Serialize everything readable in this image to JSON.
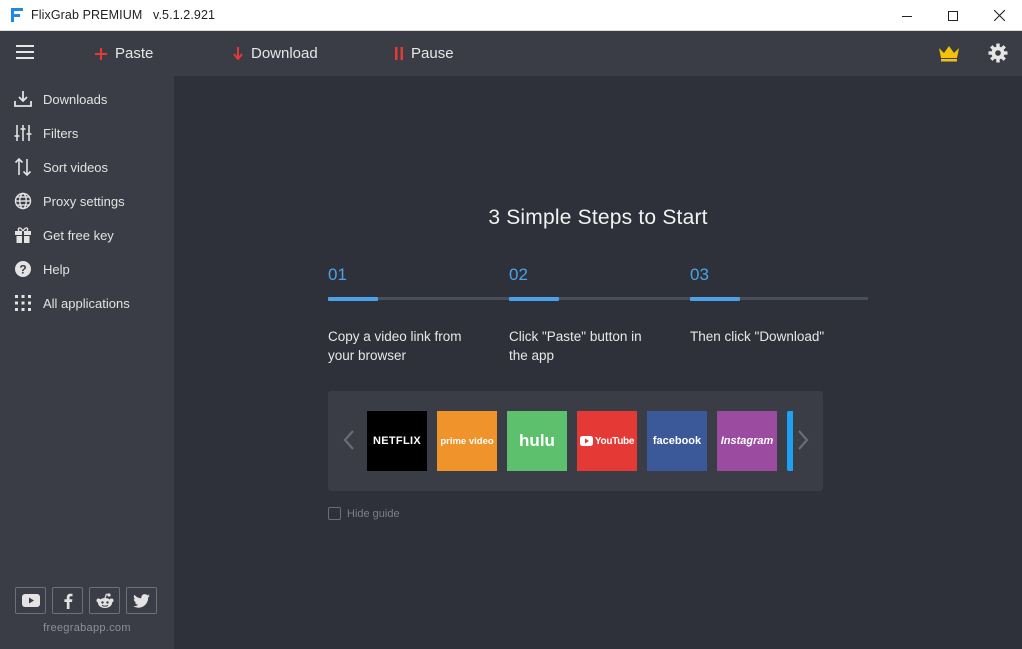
{
  "titlebar": {
    "title": "FlixGrab PREMIUM   v.5.1.2.921"
  },
  "toolbar": {
    "paste_label": "Paste",
    "download_label": "Download",
    "pause_label": "Pause",
    "icons": {
      "menu": "hamburger-menu-icon",
      "paste": "plus-icon",
      "download": "arrow-down-icon",
      "pause": "pause-icon",
      "premium": "crown-icon",
      "settings": "gear-icon"
    }
  },
  "sidebar": {
    "items": [
      {
        "label": "Downloads",
        "icon": "download-tray-icon"
      },
      {
        "label": "Filters",
        "icon": "sliders-icon"
      },
      {
        "label": "Sort videos",
        "icon": "sort-arrows-icon"
      },
      {
        "label": "Proxy settings",
        "icon": "globe-icon"
      },
      {
        "label": "Get free key",
        "icon": "gift-icon"
      },
      {
        "label": "Help",
        "icon": "question-icon"
      },
      {
        "label": "All applications",
        "icon": "grid-dots-icon"
      }
    ],
    "social": [
      "youtube-icon",
      "facebook-icon",
      "reddit-icon",
      "twitter-icon"
    ],
    "site": "freegrabapp.com"
  },
  "guide": {
    "heading": "3 Simple Steps to Start",
    "steps": [
      {
        "num": "01",
        "line1": "Copy a video link from",
        "line2": "your browser"
      },
      {
        "num": "02",
        "line1": "Click \"Paste\" button in",
        "line2": "the app"
      },
      {
        "num": "03",
        "line1": "Then click \"Download\"",
        "line2": ""
      }
    ],
    "services": [
      {
        "name": "NETFLIX",
        "color": "#000000"
      },
      {
        "name": "prime video",
        "color": "#f0932b"
      },
      {
        "name": "hulu",
        "color": "#5cc06c"
      },
      {
        "name": "YouTube",
        "color": "#e53935"
      },
      {
        "name": "facebook",
        "color": "#3b5998"
      },
      {
        "name": "Instagram",
        "color": "#9b4ba0"
      }
    ],
    "hide_label": "Hide guide"
  },
  "colors": {
    "accent": "#4aa3e8",
    "sidebar_bg": "#3a3d45",
    "main_bg": "#2e3139",
    "toolbar_red": "#e53935"
  }
}
